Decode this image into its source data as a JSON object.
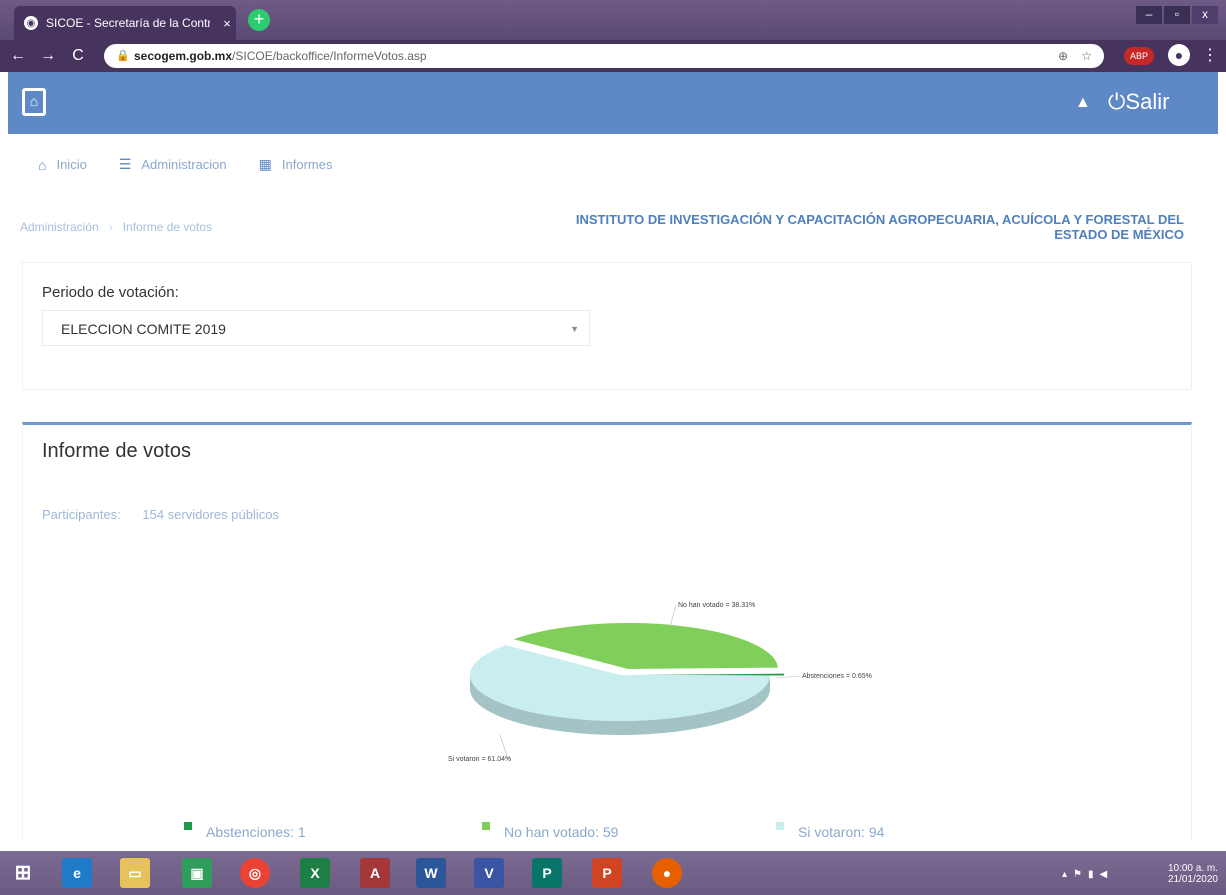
{
  "browser": {
    "tab_title": "SICOE - Secretaría de la Contralo",
    "tab_close": "×",
    "new_tab": "+",
    "url_domain": "secogem.gob.mx",
    "url_path": "/SICOE/backoffice/InformeVotos.asp",
    "extension_badge": "ABP",
    "window_controls": {
      "minimize": "–",
      "maximize": "▫",
      "close": "x"
    }
  },
  "header": {
    "logout_label": "Salir"
  },
  "nav": {
    "items": [
      {
        "label": "Inicio",
        "icon": "home-icon"
      },
      {
        "label": "Administracion",
        "icon": "list-icon"
      },
      {
        "label": "Informes",
        "icon": "report-icon"
      }
    ]
  },
  "breadcrumb": {
    "items": [
      "Administración",
      "Informe de votos"
    ]
  },
  "institution": {
    "line1": "INSTITUTO DE INVESTIGACIÓN Y CAPACITACIÓN AGROPECUARIA, ACUÍCOLA Y FORESTAL DEL",
    "line2": "ESTADO DE MÉXICO"
  },
  "periodo": {
    "label": "Periodo de votación:",
    "selected": "ELECCION COMITE 2019"
  },
  "informe": {
    "title": "Informe de votos",
    "participants_label": "Participantes:",
    "participants_value": "154 servidores públicos"
  },
  "chart_data": {
    "type": "pie",
    "series": [
      {
        "name": "Abstenciones",
        "value": 1,
        "percent": 0.65,
        "label": "Abstenciones = 0.65%",
        "color": "#1e9a4b"
      },
      {
        "name": "No han votado",
        "value": 59,
        "percent": 38.31,
        "label": "No han votado = 38.31%",
        "color": "#7fcf5a"
      },
      {
        "name": "Si votaron",
        "value": 94,
        "percent": 61.04,
        "label": "Si votaron = 61.04%",
        "color": "#c8eef0"
      }
    ]
  },
  "legend": [
    {
      "text": "Abstenciones: 1",
      "color": "#1e9a4b"
    },
    {
      "text": "No han votado: 59",
      "color": "#7fcf5a"
    },
    {
      "text": "Si votaron: 94",
      "color": "#c8eef0"
    }
  ],
  "taskbar": {
    "time": "10:00 a. m.",
    "date": "21/01/2020"
  }
}
